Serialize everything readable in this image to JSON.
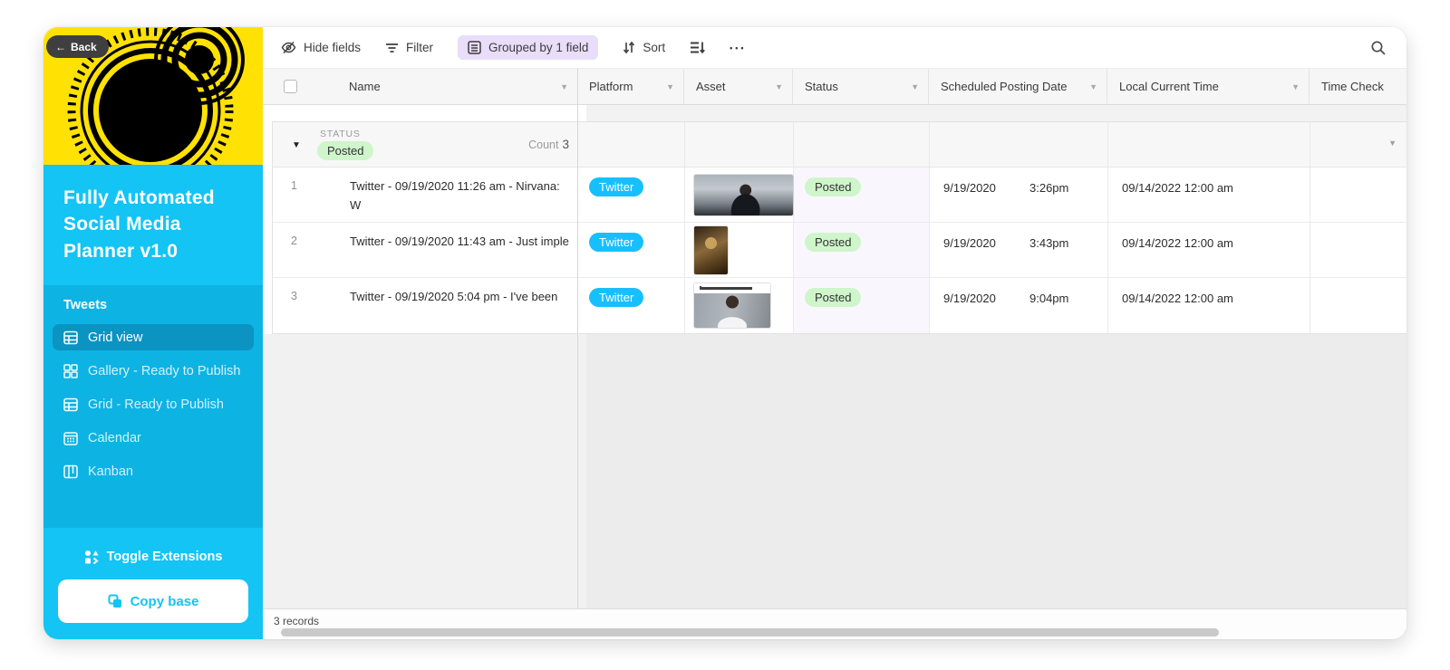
{
  "colors": {
    "yellow": "#ffe204",
    "cyan": "#13c4f4",
    "cyan_dark": "#0db3e3",
    "cyan_selected": "#0b93c2",
    "twitter": "#18bfff",
    "posted": "#cff5cb",
    "status_bg": "#faf6fe",
    "group_pill": "#e9ddfa"
  },
  "sidebar": {
    "back_label": "Back",
    "title": "Fully Automated Social Media Planner v1.0",
    "section_label": "Tweets",
    "views": [
      {
        "label": "Grid view"
      },
      {
        "label": "Gallery - Ready to Publish"
      },
      {
        "label": "Grid - Ready to Publish"
      },
      {
        "label": "Calendar"
      },
      {
        "label": "Kanban"
      }
    ],
    "toggle_extensions_label": "Toggle Extensions",
    "copy_base_label": "Copy base"
  },
  "toolbar": {
    "hide_fields_label": "Hide fields",
    "filter_label": "Filter",
    "group_label": "Grouped by 1 field",
    "sort_label": "Sort",
    "more_glyph": "•••"
  },
  "table": {
    "columns": [
      "Name",
      "Platform",
      "Asset",
      "Status",
      "Scheduled Posting Date",
      "Local Current Time",
      "Time Check"
    ],
    "group": {
      "field_label": "STATUS",
      "value": "Posted",
      "count_label": "Count",
      "count": "3"
    },
    "rows": [
      {
        "num": "1",
        "name": "Twitter - 09/19/2020 11:26 am - Nirvana: W",
        "platform": "Twitter",
        "status": "Posted",
        "scheduled_date": "9/19/2020",
        "scheduled_time": "3:26pm",
        "local_current_time": "09/14/2022 12:00 am"
      },
      {
        "num": "2",
        "name": "Twitter - 09/19/2020 11:43 am - Just imple",
        "platform": "Twitter",
        "status": "Posted",
        "scheduled_date": "9/19/2020",
        "scheduled_time": "3:43pm",
        "local_current_time": "09/14/2022 12:00 am"
      },
      {
        "num": "3",
        "name": "Twitter - 09/19/2020 5:04 pm - I've been",
        "platform": "Twitter",
        "status": "Posted",
        "scheduled_date": "9/19/2020",
        "scheduled_time": "9:04pm",
        "local_current_time": "09/14/2022 12:00 am"
      }
    ],
    "footer": "3 records"
  }
}
